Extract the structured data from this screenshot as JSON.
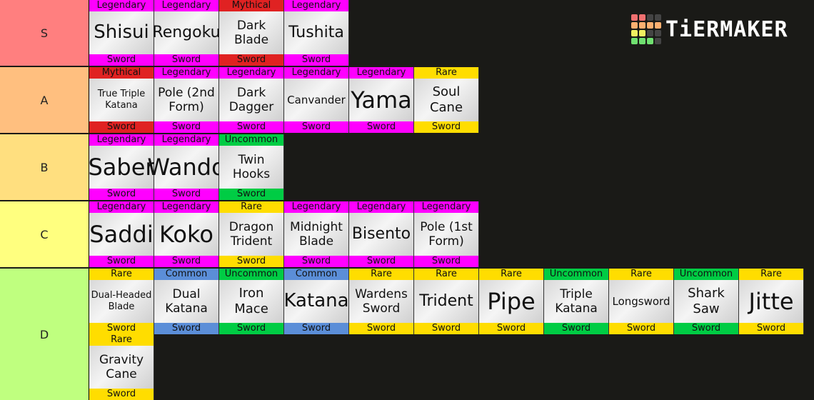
{
  "logo": {
    "text": "TiERMAKER"
  },
  "rarity_colors": {
    "Legendary": "#ff00ff",
    "Mythical": "#e02222",
    "Rare": "#ffdd00",
    "Common": "#5b8ed8",
    "Uncommon": "#00cc44"
  },
  "tiers": [
    {
      "label": "S",
      "color": "#ff7f7f",
      "items": [
        {
          "name": "Shisui",
          "rarity": "Legendary",
          "type": "Sword"
        },
        {
          "name": "Rengoku",
          "rarity": "Legendary",
          "type": "Sword"
        },
        {
          "name": "Dark Blade",
          "rarity": "Mythical",
          "type": "Sword"
        },
        {
          "name": "Tushita",
          "rarity": "Legendary",
          "type": "Sword"
        }
      ]
    },
    {
      "label": "A",
      "color": "#ffbf7f",
      "items": [
        {
          "name": "True Triple Katana",
          "rarity": "Mythical",
          "type": "Sword"
        },
        {
          "name": "Pole (2nd Form)",
          "rarity": "Legendary",
          "type": "Sword"
        },
        {
          "name": "Dark Dagger",
          "rarity": "Legendary",
          "type": "Sword"
        },
        {
          "name": "Canvander",
          "rarity": "Legendary",
          "type": "Sword"
        },
        {
          "name": "Yama",
          "rarity": "Legendary",
          "type": "Sword"
        },
        {
          "name": "Soul Cane",
          "rarity": "Rare",
          "type": "Sword"
        }
      ]
    },
    {
      "label": "B",
      "color": "#ffdf7f",
      "items": [
        {
          "name": "Saber",
          "rarity": "Legendary",
          "type": "Sword"
        },
        {
          "name": "Wando",
          "rarity": "Legendary",
          "type": "Sword"
        },
        {
          "name": "Twin Hooks",
          "rarity": "Uncommon",
          "type": "Sword"
        }
      ]
    },
    {
      "label": "C",
      "color": "#ffff7f",
      "items": [
        {
          "name": "Saddi",
          "rarity": "Legendary",
          "type": "Sword"
        },
        {
          "name": "Koko",
          "rarity": "Legendary",
          "type": "Sword"
        },
        {
          "name": "Dragon Trident",
          "rarity": "Rare",
          "type": "Sword"
        },
        {
          "name": "Midnight Blade",
          "rarity": "Legendary",
          "type": "Sword"
        },
        {
          "name": "Bisento",
          "rarity": "Legendary",
          "type": "Sword"
        },
        {
          "name": "Pole (1st Form)",
          "rarity": "Legendary",
          "type": "Sword"
        }
      ]
    },
    {
      "label": "D",
      "color": "#bfff7f",
      "items": [
        {
          "name": "Dual-Headed Blade",
          "rarity": "Rare",
          "type": "Sword"
        },
        {
          "name": "Dual Katana",
          "rarity": "Common",
          "type": "Sword"
        },
        {
          "name": "Iron Mace",
          "rarity": "Uncommon",
          "type": "Sword"
        },
        {
          "name": "Katana",
          "rarity": "Common",
          "type": "Sword"
        },
        {
          "name": "Wardens Sword",
          "rarity": "Rare",
          "type": "Sword"
        },
        {
          "name": "Trident",
          "rarity": "Rare",
          "type": "Sword"
        },
        {
          "name": "Pipe",
          "rarity": "Rare",
          "type": "Sword"
        },
        {
          "name": "Triple Katana",
          "rarity": "Uncommon",
          "type": "Sword"
        },
        {
          "name": "Longsword",
          "rarity": "Rare",
          "type": "Sword"
        },
        {
          "name": "Shark Saw",
          "rarity": "Uncommon",
          "type": "Sword"
        },
        {
          "name": "Jitte",
          "rarity": "Rare",
          "type": "Sword"
        },
        {
          "name": "Gravity Cane",
          "rarity": "Rare",
          "type": "Sword"
        }
      ]
    }
  ]
}
